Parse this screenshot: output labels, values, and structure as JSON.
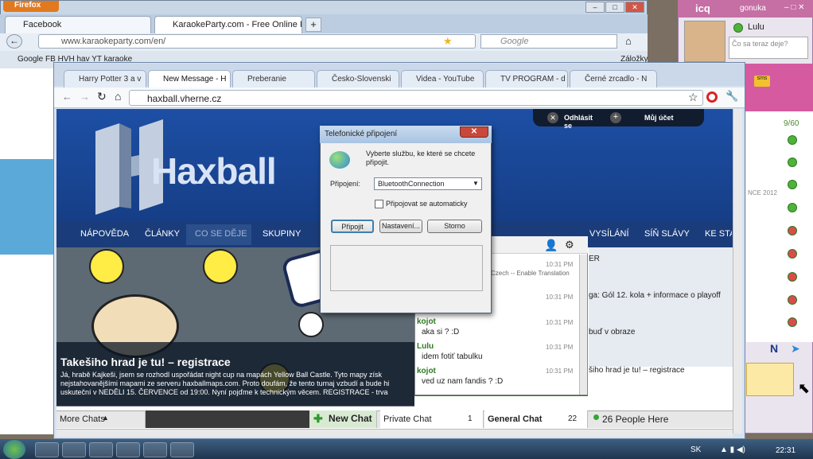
{
  "firefox": {
    "button": "Firefox",
    "tabs": [
      "Facebook",
      "KaraokeParty.com - Free Online Kara..."
    ],
    "url": "www.karaokeparty.com/en/",
    "search_placeholder": "Google",
    "bookmarks": "Google  FB  HVH  hav  YT  karaoke",
    "bookmarks_right": "Záložky"
  },
  "icq": {
    "title": "icq",
    "status": "gonuka",
    "contact": "Lulu",
    "input_placeholder": "Čo sa teraz deje?",
    "count": "9/60",
    "note": "NCE 2012"
  },
  "chrome": {
    "tabs": [
      "Harry Potter 3 a v",
      "New Message - H",
      "Preberanie",
      "Česko-Slovenski",
      "Videa - YouTube",
      "TV PROGRAM - d",
      "Černé zrcadlo - N"
    ],
    "url": "haxball.vherne.cz"
  },
  "site": {
    "logo": "Haxball",
    "account": {
      "logout": "Odhlásit se",
      "profile": "Můj účet"
    },
    "menu": [
      "NÁPOVĚDA",
      "ČLÁNKY",
      "CO SE DĚJE",
      "SKUPINY",
      "VYSÍLÁNÍ",
      "SÍŇ SLÁVY",
      "KE STA"
    ],
    "hero_title": "Takešiho hrad je tu! – registrace",
    "hero_text": "Já, hrabě Kajkeši, jsem se rozhodl uspořádat night cup na mapách Yellow Ball Castle. Tyto mapy získ nejstahovanějšími mapami ze serveru haxballmaps.com. Proto doufám, že tento turnaj vzbudí a bude hi uskuteční v NEDĚLI 15. ČERVENCE od 19:00. Nyní pojďme k technickým věcem. REGISTRACE - trva",
    "right_lines": [
      "ER",
      "ga: Gól 12. kola + informace o playoff",
      "buď v obraze",
      "šiho hrad je tu! – registrace"
    ]
  },
  "chat": {
    "translate": "Czech -- Enable Translation",
    "messages": [
      {
        "nick": "",
        "text": "",
        "time": "10:31 PM"
      },
      {
        "nick": "",
        "text": "",
        "time": "10:31 PM"
      },
      {
        "nick": "kojot",
        "text": "aka si ? :D",
        "time": "10:31 PM"
      },
      {
        "nick": "Lulu",
        "text": "idem fotiť tabulku",
        "time": "10:31 PM"
      },
      {
        "nick": "kojot",
        "text": "ved uz nam fandis ? :D",
        "time": "10:31 PM"
      }
    ],
    "bar": {
      "more": "More Chats",
      "new": "New Chat",
      "private": "Private Chat",
      "private_count": "1",
      "general": "General Chat",
      "general_count": "22",
      "people": "26 People Here"
    }
  },
  "dialog": {
    "title": "Telefonické připojení",
    "text": "Vyberte službu, ke které se chcete připojit.",
    "label": "Připojení:",
    "selected": "BluetoothConnection",
    "checkbox": "Připojovat se automaticky",
    "buttons": [
      "Připojit",
      "Nastavení...",
      "Storno"
    ]
  },
  "taskbar": {
    "lang": "SK",
    "clock": "22:31"
  }
}
